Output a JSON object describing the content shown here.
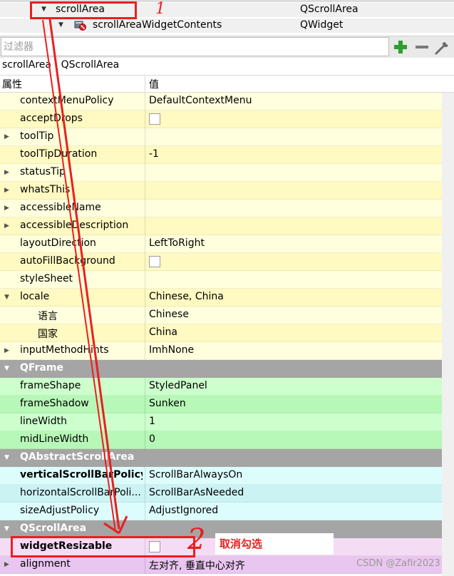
{
  "object_tree": {
    "rows": [
      {
        "name": "scrollArea",
        "class": "QScrollArea",
        "expanded": true
      },
      {
        "name": "scrollAreaWidgetContents",
        "class": "QWidget",
        "expanded": true,
        "icon": "widget-icon"
      }
    ]
  },
  "filter": {
    "placeholder": "过滤器",
    "add_icon": "plus-icon",
    "remove_icon": "minus-icon",
    "config_icon": "wrench-icon",
    "add_color": "#2e9e2e"
  },
  "current_object": "scrollArea : QScrollArea",
  "table_header": {
    "property": "属性",
    "value": "值"
  },
  "rows": {
    "contextMenuPolicy": {
      "name": "contextMenuPolicy",
      "value": "DefaultContextMenu"
    },
    "acceptDrops": {
      "name": "acceptDrops",
      "checked": false
    },
    "toolTip": {
      "name": "toolTip",
      "value": ""
    },
    "toolTipDuration": {
      "name": "toolTipDuration",
      "value": "-1"
    },
    "statusTip": {
      "name": "statusTip",
      "value": ""
    },
    "whatsThis": {
      "name": "whatsThis",
      "value": ""
    },
    "accessibleName": {
      "name": "accessibleName",
      "value": ""
    },
    "accessibleDescription": {
      "name": "accessibleDescription",
      "value": ""
    },
    "layoutDirection": {
      "name": "layoutDirection",
      "value": "LeftToRight"
    },
    "autoFillBackground": {
      "name": "autoFillBackground",
      "checked": false
    },
    "styleSheet": {
      "name": "styleSheet",
      "value": ""
    },
    "locale": {
      "name": "locale",
      "value": "Chinese, China"
    },
    "language": {
      "name": "语言",
      "value": "Chinese"
    },
    "country": {
      "name": "国家",
      "value": "China"
    },
    "inputMethodHints": {
      "name": "inputMethodHints",
      "value": "ImhNone"
    },
    "frameShape": {
      "name": "frameShape",
      "value": "StyledPanel"
    },
    "frameShadow": {
      "name": "frameShadow",
      "value": "Sunken"
    },
    "lineWidth": {
      "name": "lineWidth",
      "value": "1"
    },
    "midLineWidth": {
      "name": "midLineWidth",
      "value": "0"
    },
    "verticalScrollBarPolicy": {
      "name": "verticalScrollBarPolicy",
      "value": "ScrollBarAlwaysOn"
    },
    "horizontalScrollBarPolicy": {
      "name": "horizontalScrollBarPoli...",
      "value": "ScrollBarAsNeeded"
    },
    "sizeAdjustPolicy": {
      "name": "sizeAdjustPolicy",
      "value": "AdjustIgnored"
    },
    "widgetResizable": {
      "name": "widgetResizable",
      "checked": false
    },
    "alignment": {
      "name": "alignment",
      "value": "左对齐, 垂直中心对齐"
    }
  },
  "groups": {
    "qframe": "QFrame",
    "qabstractscrollarea": "QAbstractScrollArea",
    "qscrollarea": "QScrollArea"
  },
  "annotations": {
    "step1": "1",
    "step2": "2",
    "note": "取消勾选",
    "color": "#ea1f1f"
  },
  "watermark": "CSDN @Zafir2023"
}
